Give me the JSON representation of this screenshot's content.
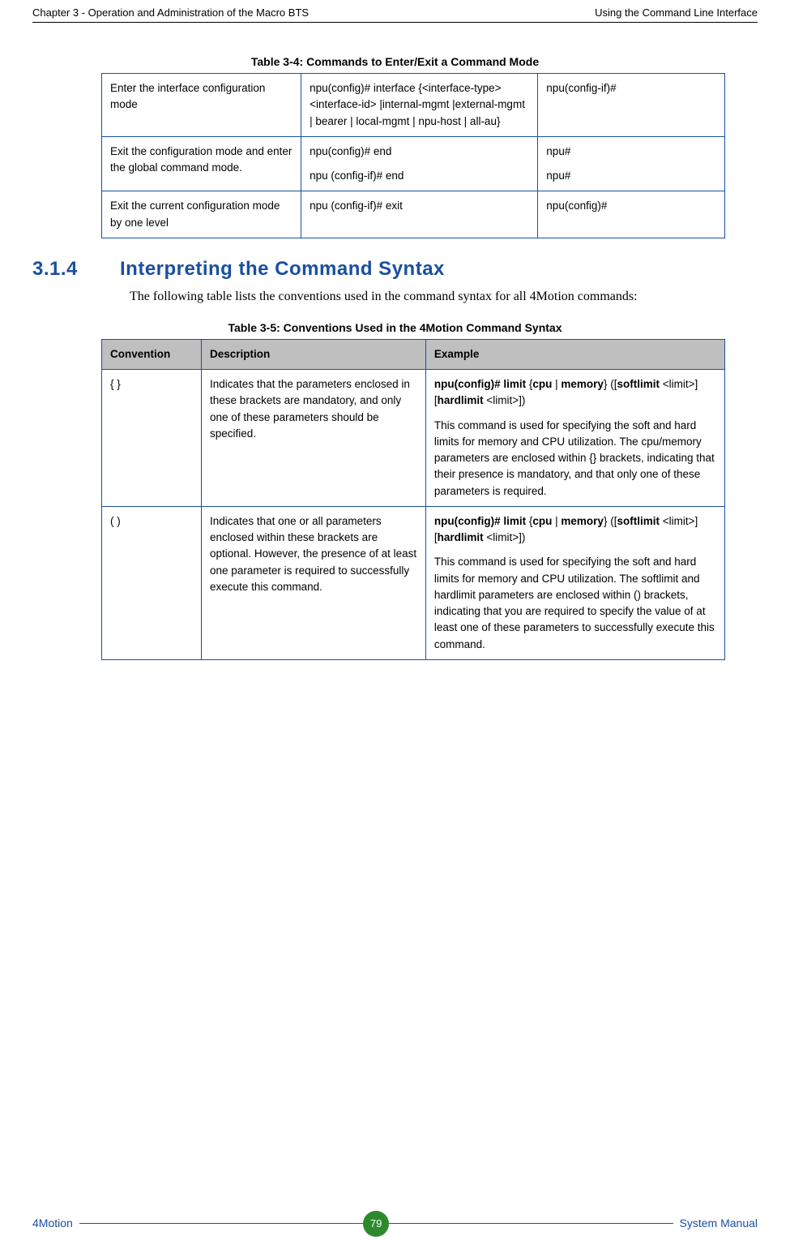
{
  "header": {
    "left": "Chapter 3 - Operation and Administration of the Macro BTS",
    "right": "Using the Command Line Interface"
  },
  "table34": {
    "caption": "Table 3-4: Commands to Enter/Exit a Command Mode",
    "rows": [
      {
        "c1": "Enter the interface configuration mode",
        "c2": "npu(config)# interface {<interface-type> <interface-id> |internal-mgmt |external-mgmt | bearer | local-mgmt | npu-host | all-au}",
        "c3": "npu(config-if)#"
      },
      {
        "c1": "Exit the configuration mode and enter the global command mode.",
        "c2a": "npu(config)# end",
        "c2b": "npu (config-if)# end",
        "c3a": "npu#",
        "c3b": "npu#"
      },
      {
        "c1": "Exit the current configuration mode by one level",
        "c2": "npu (config-if)# exit",
        "c3": "npu(config)#"
      }
    ]
  },
  "section": {
    "num": "3.1.4",
    "title": "Interpreting the Command Syntax",
    "body": "The following table lists the conventions used in the command syntax for all 4Motion commands:"
  },
  "table35": {
    "caption": "Table 3-5: Conventions Used in the 4Motion Command Syntax",
    "headers": {
      "h1": "Convention",
      "h2": "Description",
      "h3": "Example"
    },
    "rows": [
      {
        "conv": "{ }",
        "desc": "Indicates that the parameters enclosed in these brackets are mandatory, and only one of these parameters should be specified.",
        "ex_cmd_a": "npu(config)# limit ",
        "ex_cmd_b": "{",
        "ex_cmd_c": "cpu",
        "ex_cmd_d": " | ",
        "ex_cmd_e": "memory",
        "ex_cmd_f": "} ",
        "ex_cmd_g": "([",
        "ex_cmd_h": "softlimit",
        "ex_cmd_i": " <limit>]  [",
        "ex_cmd_j": "hardlimit",
        "ex_cmd_k": " <limit>])",
        "ex_body": "This command is used for specifying the soft and hard limits for memory and CPU utilization. The cpu/memory parameters are enclosed within {} brackets, indicating that their presence is mandatory, and that only one of these parameters is required."
      },
      {
        "conv": "( )",
        "desc": "Indicates that one or all parameters enclosed within these brackets are optional. However, the presence of at least one parameter is required to successfully execute this command.",
        "ex_cmd_a": "npu(config)# limit ",
        "ex_cmd_b": "{",
        "ex_cmd_c": "cpu",
        "ex_cmd_d": " | ",
        "ex_cmd_e": "memory",
        "ex_cmd_f": "} ",
        "ex_cmd_g": "([",
        "ex_cmd_h": "softlimit",
        "ex_cmd_i": " <limit>] [",
        "ex_cmd_j": "hardlimit",
        "ex_cmd_k": " <limit>])",
        "ex_body": "This command is used for specifying the soft and hard limits for memory and CPU utilization. The softlimit and hardlimit parameters are enclosed within () brackets, indicating that you are required to specify the value of at least one of these parameters to successfully execute this command."
      }
    ]
  },
  "footer": {
    "left": "4Motion",
    "page": "79",
    "right": "System Manual"
  }
}
